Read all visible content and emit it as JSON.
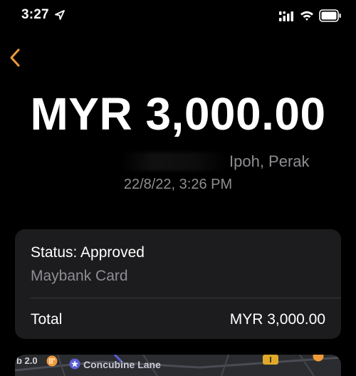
{
  "status_bar": {
    "time": "3:27",
    "icons": [
      "location-arrow-icon",
      "cellular-signal-icon",
      "wifi-icon",
      "battery-icon"
    ]
  },
  "nav": {
    "back_icon": "chevron-left-icon",
    "accent_color": "#f19a37"
  },
  "transaction": {
    "amount": "MYR 3,000.00",
    "location": "Ipoh, Perak",
    "datetime": "22/8/22, 3:26 PM"
  },
  "details": {
    "status": "Status: Approved",
    "card": "Maybank Card",
    "total_label": "Total",
    "total_value": "MYR 3,000.00"
  },
  "map": {
    "partial_label": "b 2.0",
    "street": "Concubine Lane",
    "poi_color": "#f19a37",
    "star_color": "#5a5fd6"
  },
  "colors": {
    "background": "#000000",
    "card_background": "#1c1c1e",
    "secondary_text": "#8e8e93",
    "divider": "#38383a"
  }
}
